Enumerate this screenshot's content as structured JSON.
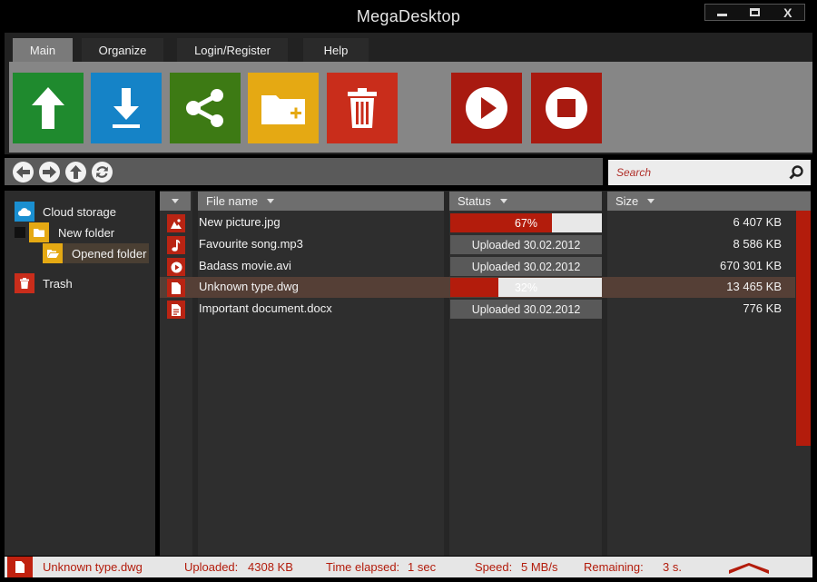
{
  "window": {
    "title": "MegaDesktop",
    "controls": {
      "minimize": "minimize",
      "maximize": "maximize",
      "close": "X"
    }
  },
  "ribbon": {
    "tabs": [
      {
        "label": "Main",
        "active": true
      },
      {
        "label": "Organize",
        "active": false
      },
      {
        "label": "Login/Register",
        "active": false
      },
      {
        "label": "Help",
        "active": false
      }
    ],
    "tiles": [
      {
        "icon": "upload-icon",
        "color": "#1f8a2e"
      },
      {
        "icon": "download-icon",
        "color": "#1583c7"
      },
      {
        "icon": "share-icon",
        "color": "#3d7a14"
      },
      {
        "icon": "new-folder-icon",
        "color": "#e5a913"
      },
      {
        "icon": "delete-icon",
        "color": "#c92d1b"
      },
      {
        "icon": "play-icon",
        "color": "#a81a10"
      },
      {
        "icon": "stop-icon",
        "color": "#a81a10"
      }
    ]
  },
  "navigation": {
    "buttons": [
      "back-icon",
      "forward-icon",
      "up-icon",
      "refresh-icon"
    ]
  },
  "search": {
    "placeholder": "Search"
  },
  "sidebar": {
    "cloud_storage": "Cloud storage",
    "new_folder": "New folder",
    "opened_folder": "Opened folder",
    "trash": "Trash"
  },
  "columns": {
    "file_name": "File name",
    "status": "Status",
    "size": "Size"
  },
  "files": [
    {
      "name": "New picture.jpg",
      "icon": "image-icon",
      "status": "67%",
      "progress": 0.67,
      "size": "6 407 KB",
      "selected": false
    },
    {
      "name": "Favourite song.mp3",
      "icon": "music-icon",
      "status": "Uploaded 30.02.2012",
      "progress": null,
      "size": "8 586 KB",
      "selected": false
    },
    {
      "name": "Badass movie.avi",
      "icon": "video-icon",
      "status": "Uploaded 30.02.2012",
      "progress": null,
      "size": "670 301 KB",
      "selected": false
    },
    {
      "name": "Unknown type.dwg",
      "icon": "file-icon",
      "status": "32%",
      "progress": 0.32,
      "size": "13 465 KB",
      "selected": true
    },
    {
      "name": "Important document.docx",
      "icon": "document-icon",
      "status": "Uploaded 30.02.2012",
      "progress": null,
      "size": "776 KB",
      "selected": false
    }
  ],
  "statusbar": {
    "file": "Unknown type.dwg",
    "uploaded_label": "Uploaded:",
    "uploaded_value": "4308 KB",
    "elapsed_label": "Time elapsed:",
    "elapsed_value": "1 sec",
    "speed_label": "Speed:",
    "speed_value": "5 MB/s",
    "remaining_label": "Remaining:",
    "remaining_value": "3 s."
  },
  "colors": {
    "accent": "#b31c0c",
    "upload": "#1f8a2e",
    "download": "#1583c7",
    "share": "#3d7a14",
    "folder": "#e5a913",
    "delete": "#c92d1b",
    "cloud": "#1a8fd1"
  }
}
